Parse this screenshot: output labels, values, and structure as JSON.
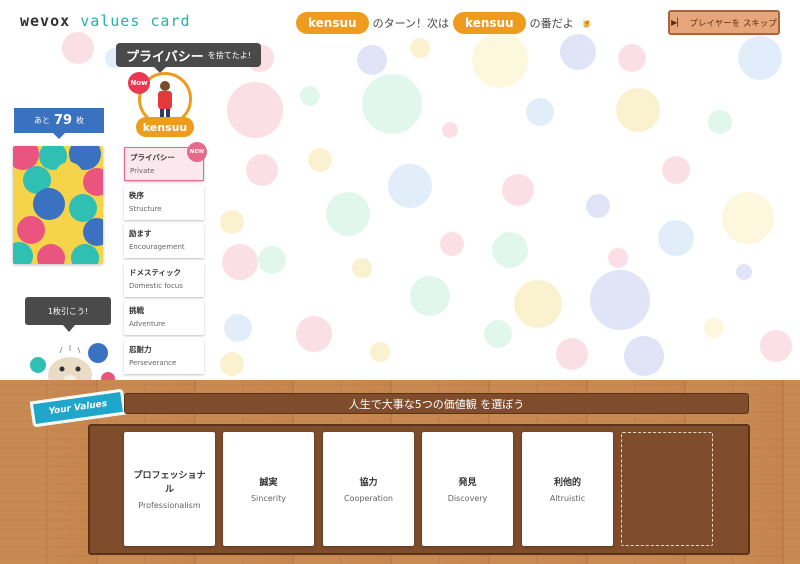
{
  "header": {
    "logo_word": "wevox",
    "logo_product": "values card",
    "turn": {
      "current_player": "kensuu",
      "mid_text": "のターン！次は",
      "next_player": "kensuu",
      "end_text": "の番だよ",
      "end_icon": "beer-icon"
    },
    "skip_label": "プレイヤーを スキップ",
    "skip_icon": "skip-icon"
  },
  "player": {
    "discard_speech_main": "プライバシー",
    "discard_speech_tail": "を捨てたよ!",
    "now_badge": "Now",
    "name": "kensuu"
  },
  "deck": {
    "prefix": "あと",
    "count": "79",
    "suffix": "枚",
    "draw_prompt": "1枚引こう!"
  },
  "discard_pile": [
    {
      "ja": "プライバシー",
      "en": "Private",
      "new": true,
      "badge": "NEW"
    },
    {
      "ja": "秩序",
      "en": "Structure",
      "new": false
    },
    {
      "ja": "励ます",
      "en": "Encouragement",
      "new": false
    },
    {
      "ja": "ドメスティック",
      "en": "Domestic focus",
      "new": false
    },
    {
      "ja": "挑戦",
      "en": "Adventure",
      "new": false
    },
    {
      "ja": "忍耐力",
      "en": "Perseverance",
      "new": false
    }
  ],
  "values_area": {
    "tag": "Your Values",
    "title": "人生で大事な5つの価値観 を選ぼう",
    "cards": [
      {
        "ja": "プロフェッショナル",
        "en": "Professionalism"
      },
      {
        "ja": "誠実",
        "en": "Sincerity"
      },
      {
        "ja": "協力",
        "en": "Cooperation"
      },
      {
        "ja": "発見",
        "en": "Discovery"
      },
      {
        "ja": "利他的",
        "en": "Altruistic"
      }
    ]
  },
  "colors": {
    "accent_orange": "#ef9b1d",
    "deck_blue": "#3a71c1",
    "new_pink": "#e56a8b",
    "wood": "#c98a52",
    "board_brown": "#7f4d2b"
  }
}
